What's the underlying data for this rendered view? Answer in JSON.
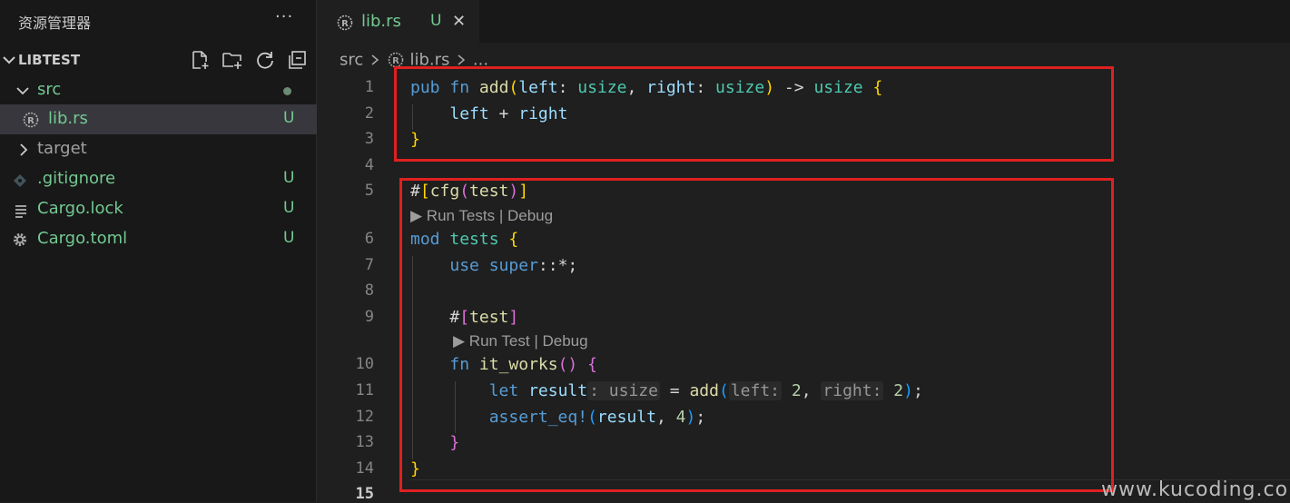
{
  "sidebar": {
    "title": "资源管理器",
    "more": "···",
    "project": "LIBTEST",
    "items": [
      {
        "label": "src",
        "status": ""
      },
      {
        "label": "lib.rs",
        "status": "U"
      },
      {
        "label": "target",
        "status": ""
      },
      {
        "label": ".gitignore",
        "status": "U"
      },
      {
        "label": "Cargo.lock",
        "status": "U"
      },
      {
        "label": "Cargo.toml",
        "status": "U"
      }
    ]
  },
  "editor": {
    "tab": {
      "label": "lib.rs",
      "status": "U",
      "close": "✕"
    },
    "breadcrumb": {
      "folder": "src",
      "file": "lib.rs",
      "ellipsis": "..."
    },
    "line_numbers": [
      "1",
      "2",
      "3",
      "4",
      "5",
      "6",
      "7",
      "8",
      "9",
      "10",
      "11",
      "12",
      "13",
      "14",
      "15"
    ],
    "code_lens": {
      "run_tests": "Run Tests",
      "run_test": "Run Test",
      "debug": "Debug",
      "sep": "|"
    },
    "inlay_hints": {
      "type": ": usize",
      "left": "left:",
      "right": "right:"
    }
  },
  "watermark": "www.kucoding.com",
  "colors": {
    "accent_green": "#73c991",
    "highlight_box": "#e02020"
  }
}
